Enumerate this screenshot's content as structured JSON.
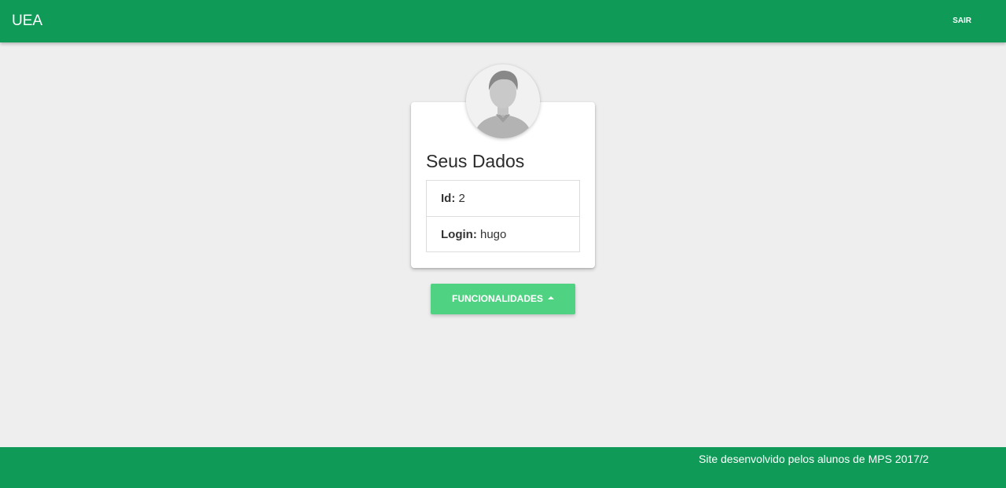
{
  "navbar": {
    "brand": "UEA",
    "logout_label": "SAIR",
    "color": "#0f9a57"
  },
  "profile": {
    "avatar_icon": "user-placeholder-icon",
    "title": "Seus Dados",
    "fields": [
      {
        "label": "Id:",
        "value": "2"
      },
      {
        "label": "Login:",
        "value": "hugo"
      }
    ]
  },
  "actions": {
    "functionalities_label": "FUNCIONALIDADES",
    "functionalities_icon": "caret-up-icon",
    "button_color": "#4fd382"
  },
  "footer": {
    "text": "Site desenvolvido pelos alunos de MPS 2017/2"
  }
}
